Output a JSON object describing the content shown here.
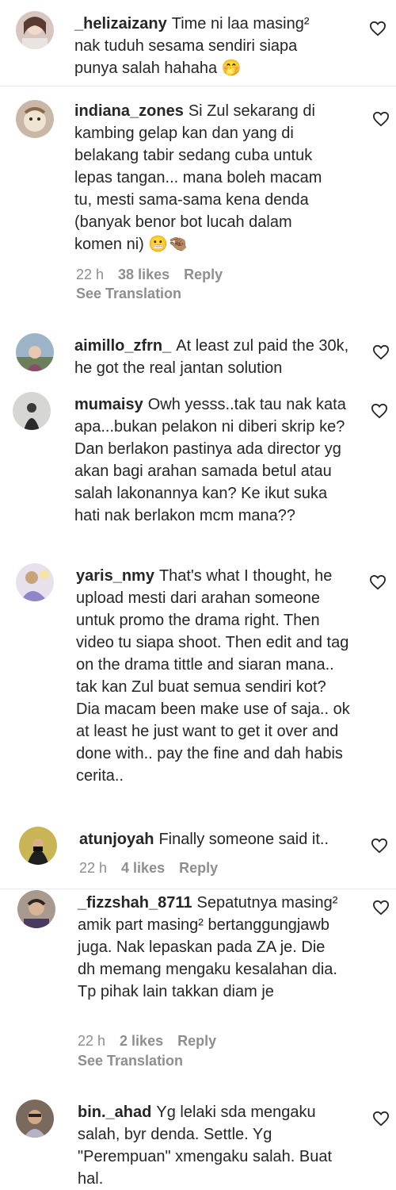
{
  "comments": [
    {
      "username": "_helizaizany",
      "text": "Time ni laa masing² nak tuduh sesama sendiri siapa punya salah hahaha 🤭"
    },
    {
      "username": "indiana_zones",
      "text": "Si Zul sekarang di kambing gelap kan dan yang di belakang tabir sedang cuba untuk lepas tangan... mana boleh macam tu, mesti sama-sama kena denda (banyak benor bot lucah dalam komen ni) 😬🤏🏽",
      "time": "22 h",
      "likes": "38 likes",
      "reply": "Reply",
      "translate": "See Translation"
    },
    {
      "username": "aimillo_zfrn_",
      "text": "At least zul paid the 30k, he got the real jantan solution"
    },
    {
      "username": "mumaisy",
      "text": "Owh yesss..tak tau nak kata apa...bukan pelakon ni diberi skrip ke? Dan berlakon pastinya ada director yg akan bagi arahan samada betul atau salah lakonannya kan? Ke ikut suka hati nak berlakon mcm mana??"
    },
    {
      "username": "yaris_nmy",
      "text": "That's what I thought, he upload mesti dari arahan someone untuk promo the drama right. Then video tu siapa shoot. Then edit and tag on the drama tittle and siaran mana.. tak kan Zul buat semua sendiri kot? Dia macam been make use of saja.. ok at least he just want to get it over and done with.. pay the fine and dah habis cerita.."
    },
    {
      "username": "atunjoyah",
      "text": "Finally someone said it..",
      "time": "22 h",
      "likes": "4 likes",
      "reply": "Reply"
    },
    {
      "username": "_fizzshah_8711",
      "text": "Sepatutnya masing² amik part masing² bertanggungjawb juga. Nak lepaskan pada ZA je. Die dh memang mengaku kesalahan dia. Tp pihak lain takkan diam je",
      "time": "22 h",
      "likes": "2 likes",
      "reply": "Reply",
      "translate": "See Translation"
    },
    {
      "username": "bin._ahad",
      "text": "Yg lelaki sda mengaku salah, byr denda. Settle. Yg \"Perempuan\" xmengaku salah. Buat hal."
    }
  ],
  "colors": {
    "text": "#262626",
    "muted": "#8e8e8e",
    "divider": "#eaeaea"
  },
  "icons": {
    "like": "heart-outline-icon"
  }
}
